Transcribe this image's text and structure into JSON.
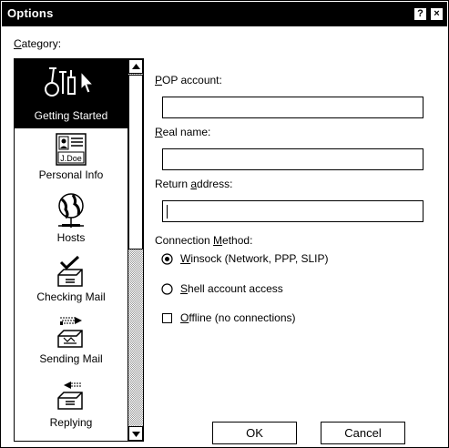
{
  "window": {
    "title": "Options",
    "help_glyph": "?",
    "close_glyph": "×"
  },
  "category": {
    "label_accesskey": "C",
    "label_rest": "ategory:",
    "items": [
      {
        "label": "Getting Started",
        "icon": "tools-icon",
        "selected": true
      },
      {
        "label": "Personal Info",
        "icon": "id-card-icon",
        "badge": "J.Doe",
        "selected": false
      },
      {
        "label": "Hosts",
        "icon": "globe-icon",
        "selected": false
      },
      {
        "label": "Checking Mail",
        "icon": "mail-check-icon",
        "selected": false
      },
      {
        "label": "Sending Mail",
        "icon": "mail-send-icon",
        "selected": false
      },
      {
        "label": "Replying",
        "icon": "mail-reply-icon",
        "selected": false
      }
    ]
  },
  "form": {
    "pop_account": {
      "accesskey": "P",
      "rest": "OP account:",
      "value": ""
    },
    "real_name": {
      "accesskey": "R",
      "rest": "eal name:",
      "value": ""
    },
    "return_address": {
      "pre": "Return ",
      "accesskey": "a",
      "rest": "ddress:",
      "value": ""
    },
    "connection": {
      "label_pre": "Connection ",
      "label_accesskey": "M",
      "label_rest": "ethod:",
      "options": [
        {
          "accesskey": "W",
          "rest": "insock (Network, PPP, SLIP)",
          "selected": true
        },
        {
          "accesskey": "S",
          "rest": "hell account access",
          "selected": false
        }
      ]
    },
    "offline": {
      "accesskey": "O",
      "rest": "ffline (no connections)",
      "checked": false
    }
  },
  "buttons": {
    "ok": "OK",
    "cancel": "Cancel"
  }
}
